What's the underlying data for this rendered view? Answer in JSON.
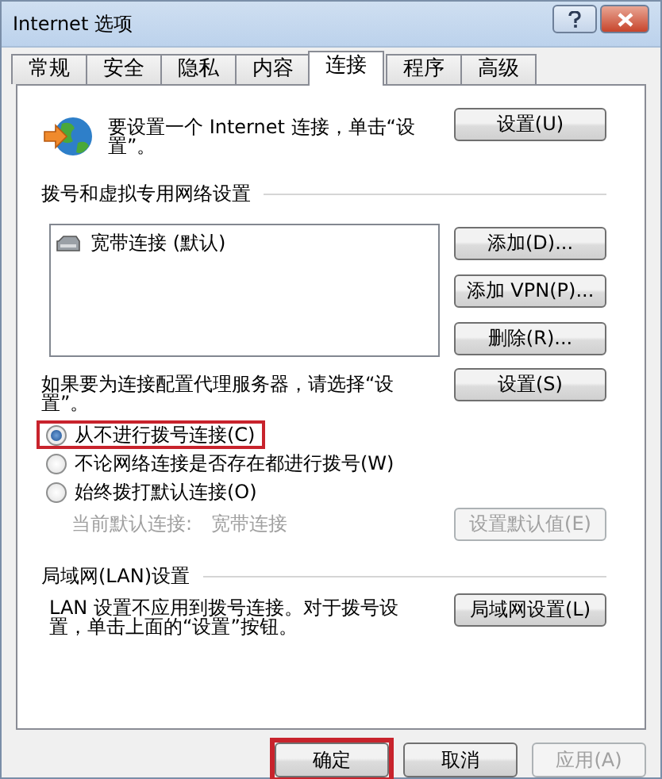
{
  "window": {
    "title": "Internet 选项"
  },
  "tabs": [
    {
      "label": "常规",
      "selected": false
    },
    {
      "label": "安全",
      "selected": false
    },
    {
      "label": "隐私",
      "selected": false
    },
    {
      "label": "内容",
      "selected": false
    },
    {
      "label": "连接",
      "selected": true
    },
    {
      "label": "程序",
      "selected": false
    },
    {
      "label": "高级",
      "selected": false
    }
  ],
  "setup": {
    "text": "要设置一个 Internet 连接，单击“设置”。",
    "button": {
      "label": "设置(U)",
      "disabled": false
    }
  },
  "dialup": {
    "heading": "拨号和虚拟专用网络设置",
    "connections": [
      {
        "label": "宽带连接 (默认)",
        "selected": false
      }
    ],
    "buttons": [
      {
        "label": "添加(D)...",
        "disabled": false
      },
      {
        "label": "添加 VPN(P)...",
        "disabled": false
      },
      {
        "label": "删除(R)...",
        "disabled": false
      }
    ]
  },
  "proxy": {
    "text": "如果要为连接配置代理服务器，请选择“设置”。",
    "button": {
      "label": "设置(S)",
      "disabled": false
    }
  },
  "dial_options": [
    {
      "label": "从不进行拨号连接(C)",
      "selected": true,
      "highlighted": true
    },
    {
      "label": "不论网络连接是否存在都进行拨号(W)",
      "selected": false,
      "highlighted": false
    },
    {
      "label": "始终拨打默认连接(O)",
      "selected": false,
      "highlighted": false
    }
  ],
  "current_default": {
    "label": "当前默认连接:",
    "value": "宽带连接",
    "disabled": true,
    "button": {
      "label": "设置默认值(E)",
      "disabled": true
    }
  },
  "lan": {
    "heading": "局域网(LAN)设置",
    "text": "LAN 设置不应用到拨号连接。对于拨号设置，单击上面的“设置”按钮。",
    "button": {
      "label": "局域网设置(L)",
      "disabled": false
    }
  },
  "footer_buttons": [
    {
      "label": "确定",
      "disabled": false,
      "highlighted": true
    },
    {
      "label": "取消",
      "disabled": false,
      "highlighted": false
    },
    {
      "label": "应用(A)",
      "disabled": true,
      "highlighted": false
    }
  ]
}
